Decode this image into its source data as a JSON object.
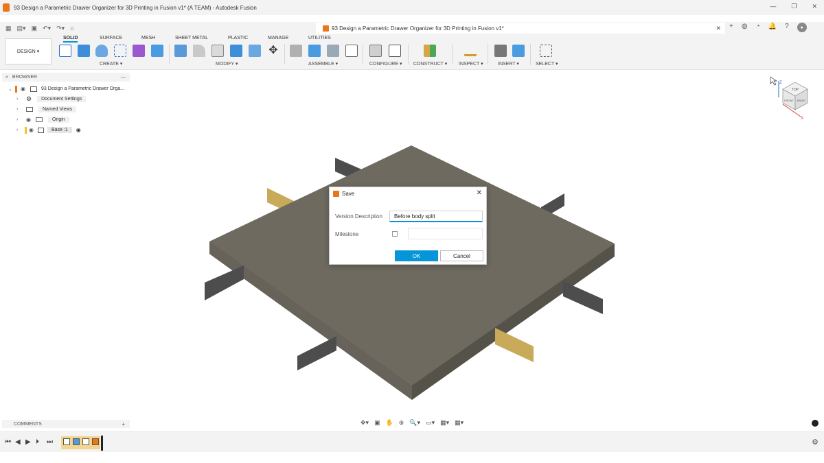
{
  "window": {
    "title": "93 Design a Parametric Drawer Organizer for 3D Printing in Fusion v1* (A TEAM) - Autodesk Fusion",
    "minimize": "—",
    "restore": "❐",
    "close": "✕"
  },
  "doc_tab": {
    "title": "93 Design a Parametric Drawer Organizer for 3D Printing in Fusion v1*",
    "close": "✕"
  },
  "workspace": {
    "label": "DESIGN ▾"
  },
  "ribbon_tabs": [
    "SOLID",
    "SURFACE",
    "MESH",
    "SHEET METAL",
    "PLASTIC",
    "MANAGE",
    "UTILITIES"
  ],
  "ribbon_groups": [
    "CREATE ▾",
    "MODIFY ▾",
    "ASSEMBLE ▾",
    "CONFIGURE ▾",
    "CONSTRUCT ▾",
    "INSPECT ▾",
    "INSERT ▾",
    "SELECT ▾"
  ],
  "browser": {
    "title": "BROWSER",
    "items": [
      {
        "label": "93 Design a Parametric Drawer Orga..."
      },
      {
        "label": "Document Settings"
      },
      {
        "label": "Named Views"
      },
      {
        "label": "Origin"
      },
      {
        "label": "Base :1"
      }
    ]
  },
  "viewcube": {
    "top": "TOP",
    "front": "FRONT",
    "right": "RIGHT",
    "z": "Z",
    "x": "X"
  },
  "dialog": {
    "title": "Save",
    "version_description_label": "Version Description",
    "version_description_value": "Before body split",
    "milestone_label": "Milestone",
    "ok_label": "OK",
    "cancel_label": "Cancel"
  },
  "comments": {
    "title": "COMMENTS"
  },
  "colors": {
    "accent": "#0696d7",
    "model_top": "#6e6a60",
    "model_side": "#5b5850",
    "plane_gray": "#4d4d4d",
    "plane_yellow": "#c9a95a"
  }
}
